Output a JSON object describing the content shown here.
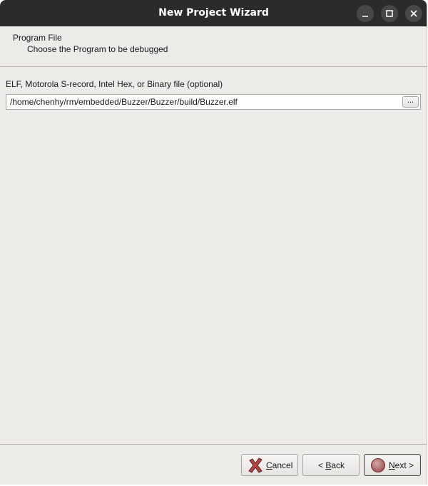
{
  "window": {
    "title": "New Project Wizard"
  },
  "header": {
    "title": "Program File",
    "subtitle": "Choose the Program to be debugged"
  },
  "program_file": {
    "label": "ELF, Motorola S-record, Intel Hex, or Binary file (optional)",
    "value": "/home/chenhy/rm/embedded/Buzzer/Buzzer/build/Buzzer.elf",
    "browse_label": "..."
  },
  "buttons": {
    "cancel": {
      "mnemonic": "C",
      "rest": "ancel"
    },
    "back": {
      "prefix": "< ",
      "mnemonic": "B",
      "rest": "ack"
    },
    "next": {
      "mnemonic": "N",
      "rest": "ext >"
    }
  },
  "icons": {
    "cancel": "red-x-icon",
    "next": "red-orb-icon",
    "minimize": "minimize-icon",
    "maximize": "maximize-icon",
    "close": "close-icon"
  },
  "colors": {
    "titlebar": "#2b2b2b",
    "window_bg": "#edebe8",
    "cancel_icon": "#b84444"
  }
}
